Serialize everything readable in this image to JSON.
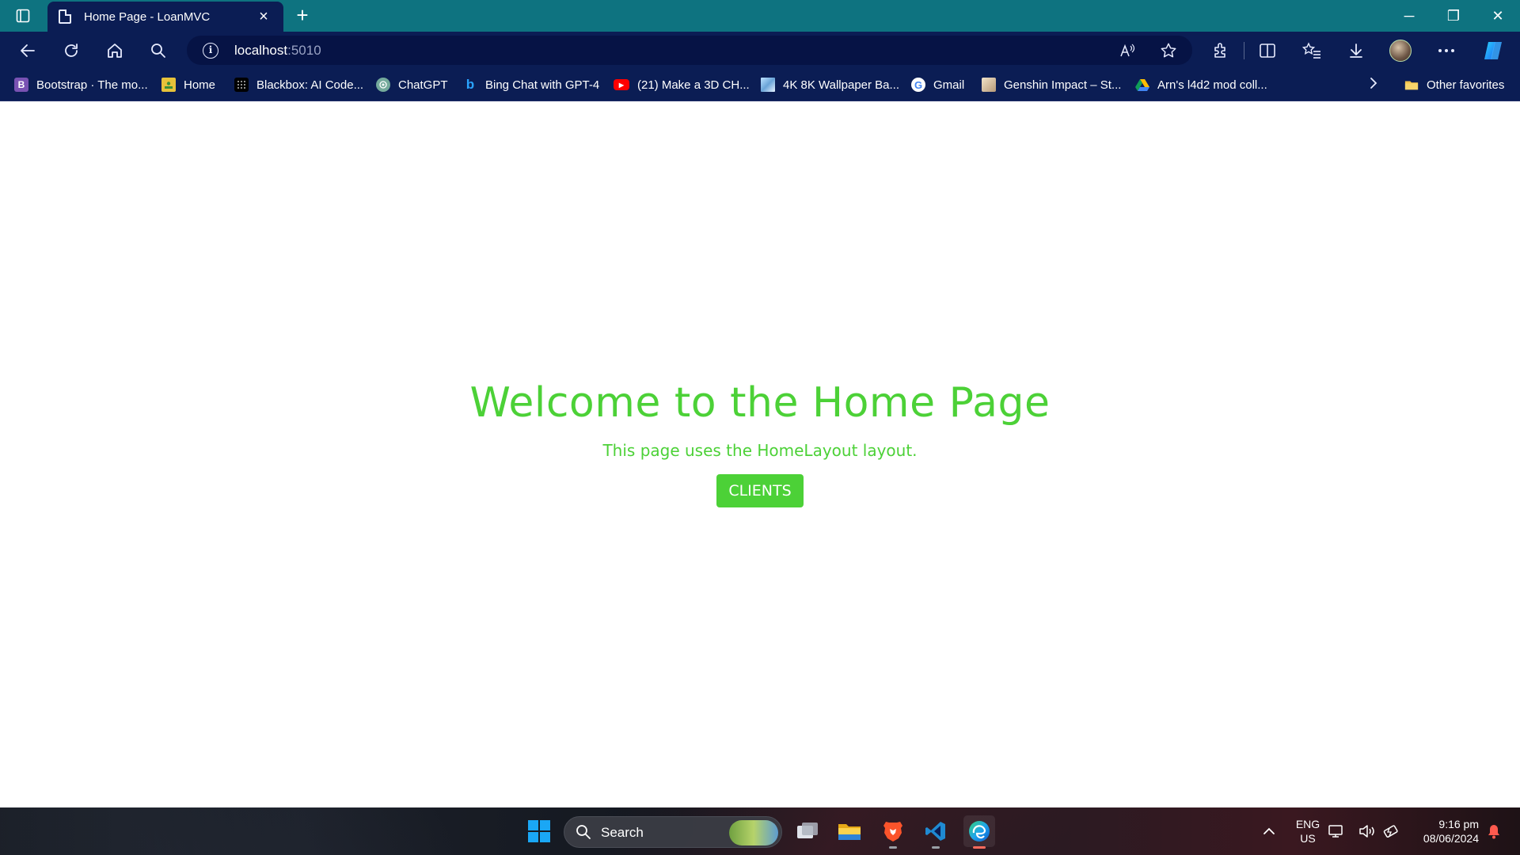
{
  "browser": {
    "tab": {
      "title": "Home Page - LoanMVC",
      "close": "×"
    },
    "new_tab": "+",
    "window_controls": {
      "minimize": "─",
      "restore": "❐",
      "close": "✕"
    },
    "address": {
      "host": "localhost",
      "port": ":5010"
    },
    "favorites": [
      {
        "label": "Bootstrap · The mo...",
        "icon": "bootstrap-icon",
        "glyph": "B",
        "color": "#7952b3"
      },
      {
        "label": "Home",
        "icon": "home-page-icon",
        "glyph": "",
        "color": "#e7c23a"
      },
      {
        "label": "Blackbox: AI Code...",
        "icon": "blackbox-icon",
        "glyph": "",
        "color": "#000000"
      },
      {
        "label": "ChatGPT",
        "icon": "chatgpt-icon",
        "glyph": "",
        "color": "#74aa9c"
      },
      {
        "label": "Bing Chat with GPT-4",
        "icon": "bing-icon",
        "glyph": "b",
        "color": "#0b1d54"
      },
      {
        "label": "(21) Make a 3D CH...",
        "icon": "youtube-icon",
        "glyph": "▶",
        "color": "#ff0000"
      },
      {
        "label": "4K 8K Wallpaper Ba...",
        "icon": "wallpaper-icon",
        "glyph": "",
        "color": "#7fb3e6"
      },
      {
        "label": "Gmail",
        "icon": "google-icon",
        "glyph": "G",
        "color": "#ffffff"
      },
      {
        "label": "Genshin Impact – St...",
        "icon": "genshin-icon",
        "glyph": "",
        "color": "#d9c6a8"
      },
      {
        "label": "Arn's l4d2 mod coll...",
        "icon": "google-drive-icon",
        "glyph": "▲",
        "color": "#0b1d54"
      }
    ],
    "other_favorites": "Other favorites"
  },
  "page": {
    "heading": "Welcome to the Home Page",
    "subtitle": "This page uses the HomeLayout layout.",
    "button_label": "CLIENTS",
    "accent_color": "#4cd137"
  },
  "taskbar": {
    "search_label": "Search",
    "language": "ENG",
    "region": "US",
    "time": "9:16 pm",
    "date": "08/06/2024"
  }
}
